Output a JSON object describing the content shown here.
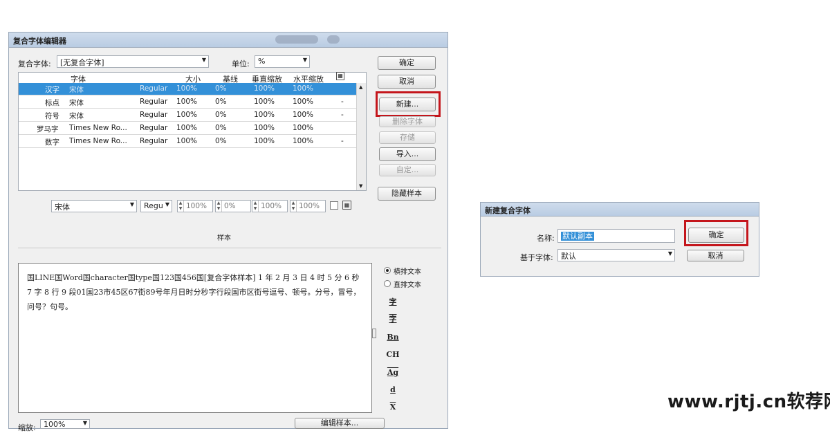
{
  "main_dialog": {
    "title": "复合字体编辑器",
    "composite_font_label": "复合字体:",
    "composite_font_value": "[无复合字体]",
    "units_label": "单位:",
    "units_value": "%",
    "columns": [
      "字体",
      "大小",
      "基线",
      "垂直缩放",
      "水平缩放"
    ],
    "rows": [
      {
        "name": "汉字",
        "font": "宋体",
        "style": "Regular",
        "size": "100%",
        "baseline": "0%",
        "vscale": "100%",
        "hscale": "100%",
        "selected": true
      },
      {
        "name": "标点",
        "font": "宋体",
        "style": "Regular",
        "size": "100%",
        "baseline": "0%",
        "vscale": "100%",
        "hscale": "100%",
        "selected": false
      },
      {
        "name": "符号",
        "font": "宋体",
        "style": "Regular",
        "size": "100%",
        "baseline": "0%",
        "vscale": "100%",
        "hscale": "100%",
        "selected": false
      },
      {
        "name": "罗马字",
        "font": "Times New Ro...",
        "style": "Regular",
        "size": "100%",
        "baseline": "0%",
        "vscale": "100%",
        "hscale": "100%",
        "selected": false
      },
      {
        "name": "数字",
        "font": "Times New Ro...",
        "style": "Regular",
        "size": "100%",
        "baseline": "0%",
        "vscale": "100%",
        "hscale": "100%",
        "selected": false
      }
    ],
    "buttons": {
      "ok": "确定",
      "cancel": "取消",
      "new": "新建...",
      "delete_font": "删除字体",
      "save": "存储",
      "import": "导入...",
      "custom": "自定...",
      "hide_sample": "隐藏样本"
    },
    "editor": {
      "font": "宋体",
      "style": "Regu",
      "size": "100%",
      "baseline": "0%",
      "vscale": "100%",
      "hscale": "100%"
    },
    "sample_label": "样本",
    "sample_text": "国LINE国Word国character国type国123国456国[复合字体样本] 1 年 2 月 3 日 4 时 5 分 6 秒 7 字 8 行 9 段01国23市45区67街89号年月日时分秒字行段国市区街号逗号、顿号。分号，冒号，问号？句号。",
    "horizontal_text": "横排文本",
    "vertical_text": "直排文本",
    "zoom_label": "缩放:",
    "zoom_value": "100%",
    "edit_sample": "编辑样本..."
  },
  "new_dialog": {
    "title": "新建复合字体",
    "name_label": "名称:",
    "name_value": "默认副本",
    "based_on_label": "基于字体:",
    "based_on_value": "默认",
    "ok": "确定",
    "cancel": "取消"
  },
  "watermark": "www.rjtj.cn软荐网",
  "colors": {
    "selection": "#3390d8",
    "highlight": "#c4161c"
  }
}
